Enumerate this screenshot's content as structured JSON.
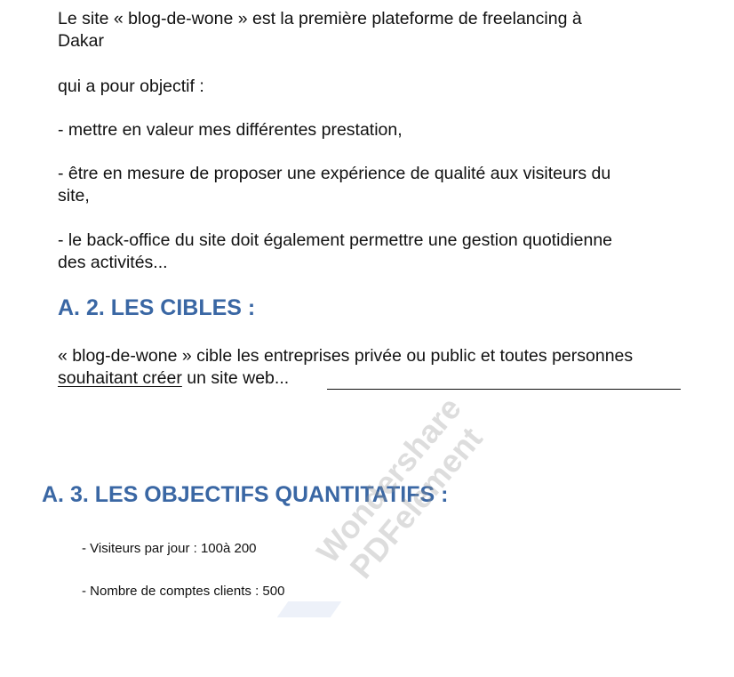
{
  "intro": {
    "line1": "Le site « blog-de-wone » est la première plateforme de freelancing à",
    "line2": "Dakar",
    "objective": "qui a pour objectif :",
    "bullet1": "- mettre en valeur mes différentes prestation,",
    "bullet2_line1": "- être en mesure de proposer une expérience de qualité aux visiteurs du",
    "bullet2_line2": "site,",
    "bullet3_line1": "- le back-office du site doit également permettre une gestion quotidienne",
    "bullet3_line2": "des activités..."
  },
  "section_cibles": {
    "heading": "A. 2. LES CIBLES :",
    "text_line1": "« blog-de-wone » cible les entreprises privée ou public et toutes personnes",
    "text_underlined": "souhaitant créer",
    "text_rest": " un site web..."
  },
  "section_objectifs": {
    "heading": "A. 3. LES OBJECTIFS QUANTITATIFS :",
    "items": [
      "- Visiteurs par jour : 100à 200",
      "- Nombre de comptes clients : 500"
    ]
  },
  "watermark": {
    "line1": "Wondershare",
    "line2": "PDFelement"
  },
  "colors": {
    "heading": "#3a67a4",
    "text": "#111111"
  }
}
